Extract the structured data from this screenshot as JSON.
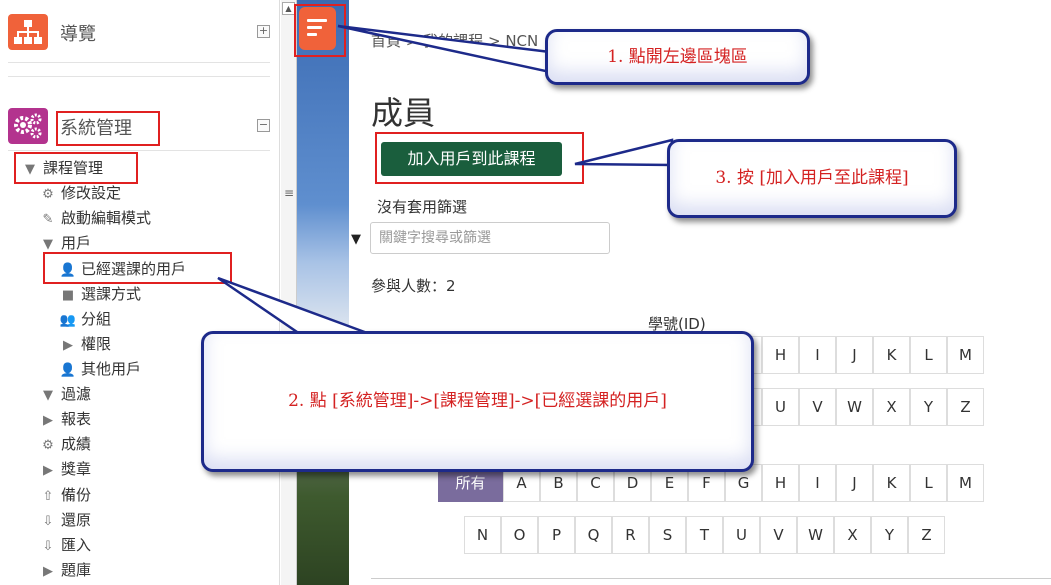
{
  "sidebar": {
    "nav_block_title": "導覽",
    "admin_block_title": "系統管理",
    "items": {
      "course_admin": "課程管理",
      "edit_settings": "修改設定",
      "edit_mode": "啟動編輯模式",
      "users": "用戶",
      "enrolled_users": "已經選課的用戶",
      "enrol_methods": "選課方式",
      "groups": "分組",
      "permissions": "權限",
      "other_users": "其他用戶",
      "filters": "過濾",
      "reports": "報表",
      "grades": "成績",
      "badges": "獎章",
      "backup": "備份",
      "restore": "還原",
      "import": "匯入",
      "question_bank": "題庫"
    }
  },
  "breadcrumb": {
    "home": "首頁",
    "sep1": ">",
    "my_courses": "我的課程",
    "sep2": ">",
    "course": "NCN"
  },
  "main": {
    "title": "成員",
    "enrol_button": "加入用戶到此課程",
    "no_filter": "沒有套用篩選",
    "search_placeholder": "關鍵字搜尋或篩選",
    "participants_count": "參與人數：2",
    "id_label": "學號(ID)",
    "all_label": "所有",
    "letters_row1": [
      "A",
      "B",
      "C",
      "D",
      "E",
      "F",
      "G",
      "H",
      "I",
      "J",
      "K",
      "L",
      "M"
    ],
    "letters_row2": [
      "N",
      "O",
      "P",
      "Q",
      "R",
      "S",
      "T",
      "U",
      "V",
      "W",
      "X",
      "Y",
      "Z"
    ]
  },
  "callouts": {
    "step1": "1. 點開左邊區塊區",
    "step2": "2. 點 [系統管理]->[課程管理]->[已經選課的用戶]",
    "step3": "3. 按 [加入用戶至此課程]"
  },
  "colors": {
    "enrol_button": "#1a5e3d",
    "menu_button": "#f0623a",
    "active_letter": "#7a6c9d",
    "highlight": "#e02020",
    "callout_border": "#1d2a8a",
    "callout_text": "#d42222"
  }
}
